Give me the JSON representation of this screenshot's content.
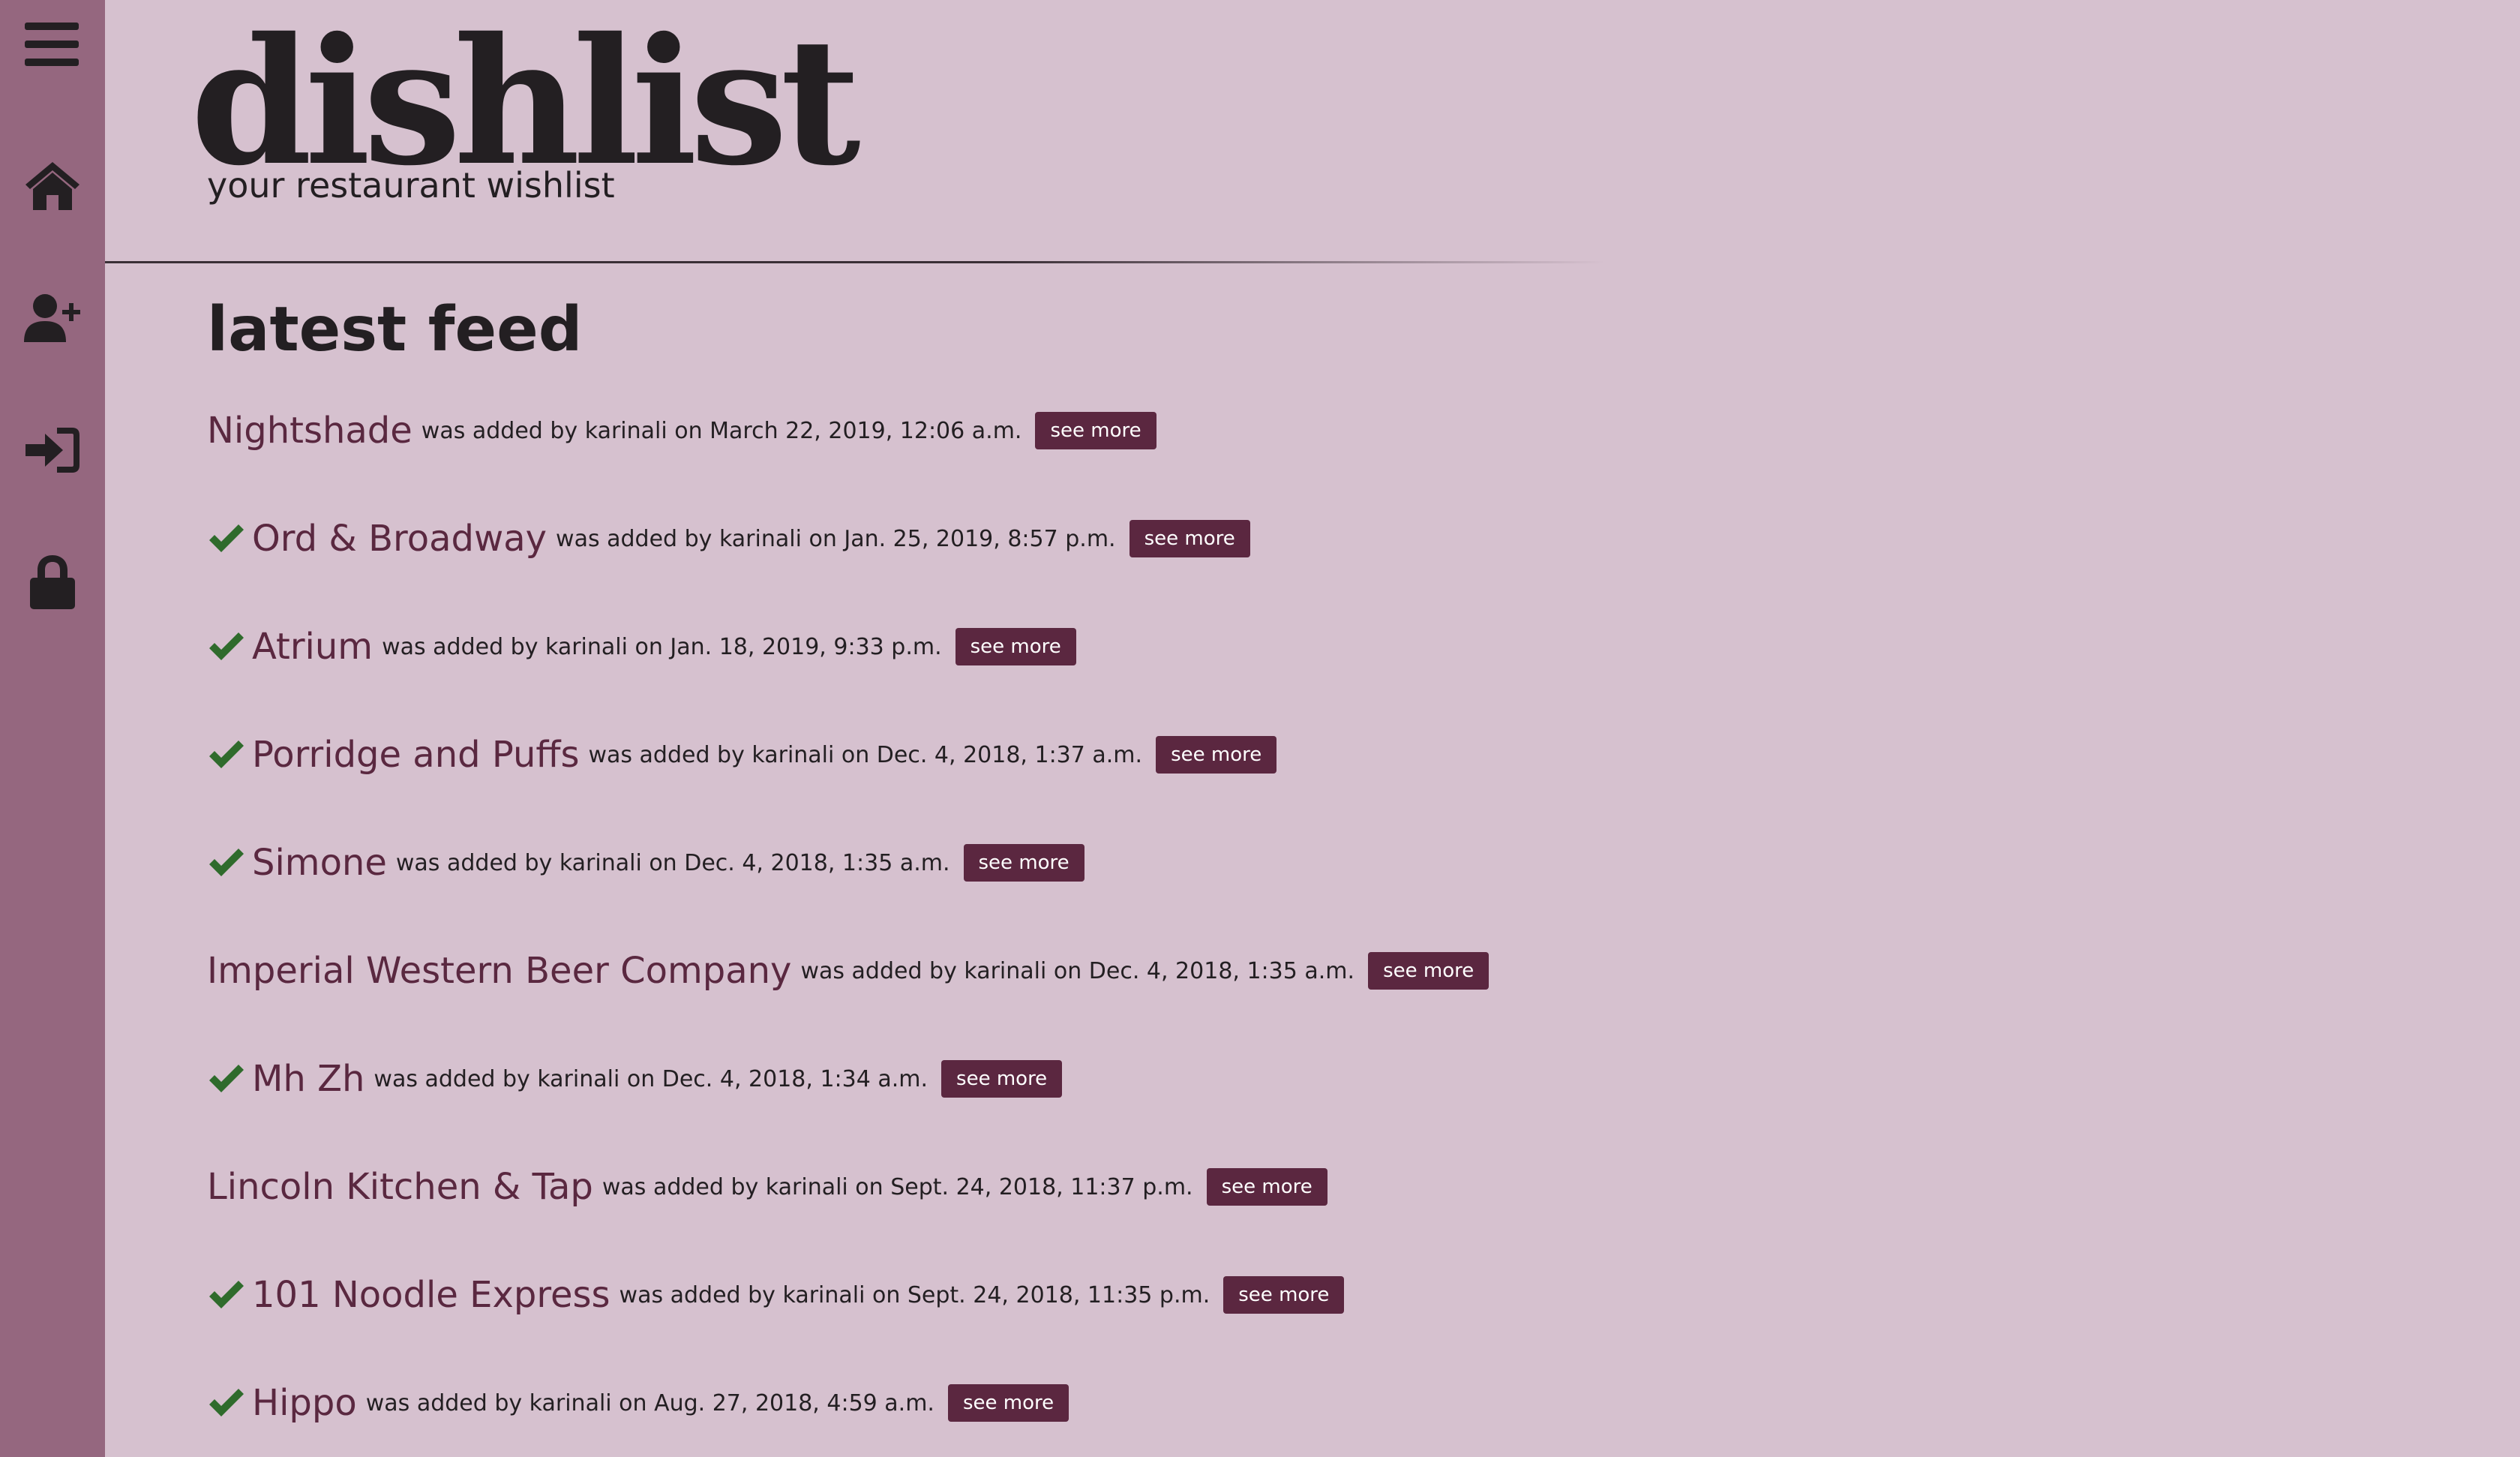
{
  "app": {
    "logo": "dishlist",
    "tagline": "your restaurant wishlist"
  },
  "sidebar": {
    "items": [
      {
        "icon": "hamburger-menu-icon"
      },
      {
        "icon": "home-icon"
      },
      {
        "icon": "user-plus-icon"
      },
      {
        "icon": "sign-in-icon"
      },
      {
        "icon": "lock-icon"
      }
    ]
  },
  "colors": {
    "background": "#d6c1cf",
    "sidebar": "#95677f",
    "accent": "#5b2740",
    "check": "#2f6b2c"
  },
  "feed": {
    "title": "latest feed",
    "button_label": "see more",
    "items": [
      {
        "checked": false,
        "name": "Nightshade",
        "meta": "was added by karinali on March 22, 2019, 12:06 a.m."
      },
      {
        "checked": true,
        "name": "Ord & Broadway",
        "meta": "was added by karinali on Jan. 25, 2019, 8:57 p.m."
      },
      {
        "checked": true,
        "name": "Atrium",
        "meta": "was added by karinali on Jan. 18, 2019, 9:33 p.m."
      },
      {
        "checked": true,
        "name": "Porridge and Puffs",
        "meta": "was added by karinali on Dec. 4, 2018, 1:37 a.m."
      },
      {
        "checked": true,
        "name": "Simone",
        "meta": "was added by karinali on Dec. 4, 2018, 1:35 a.m."
      },
      {
        "checked": false,
        "name": "Imperial Western Beer Company",
        "meta": "was added by karinali on Dec. 4, 2018, 1:35 a.m."
      },
      {
        "checked": true,
        "name": "Mh Zh",
        "meta": "was added by karinali on Dec. 4, 2018, 1:34 a.m."
      },
      {
        "checked": false,
        "name": "Lincoln Kitchen & Tap",
        "meta": "was added by karinali on Sept. 24, 2018, 11:37 p.m."
      },
      {
        "checked": true,
        "name": "101 Noodle Express",
        "meta": "was added by karinali on Sept. 24, 2018, 11:35 p.m."
      },
      {
        "checked": true,
        "name": "Hippo",
        "meta": "was added by karinali on Aug. 27, 2018, 4:59 a.m."
      }
    ]
  }
}
